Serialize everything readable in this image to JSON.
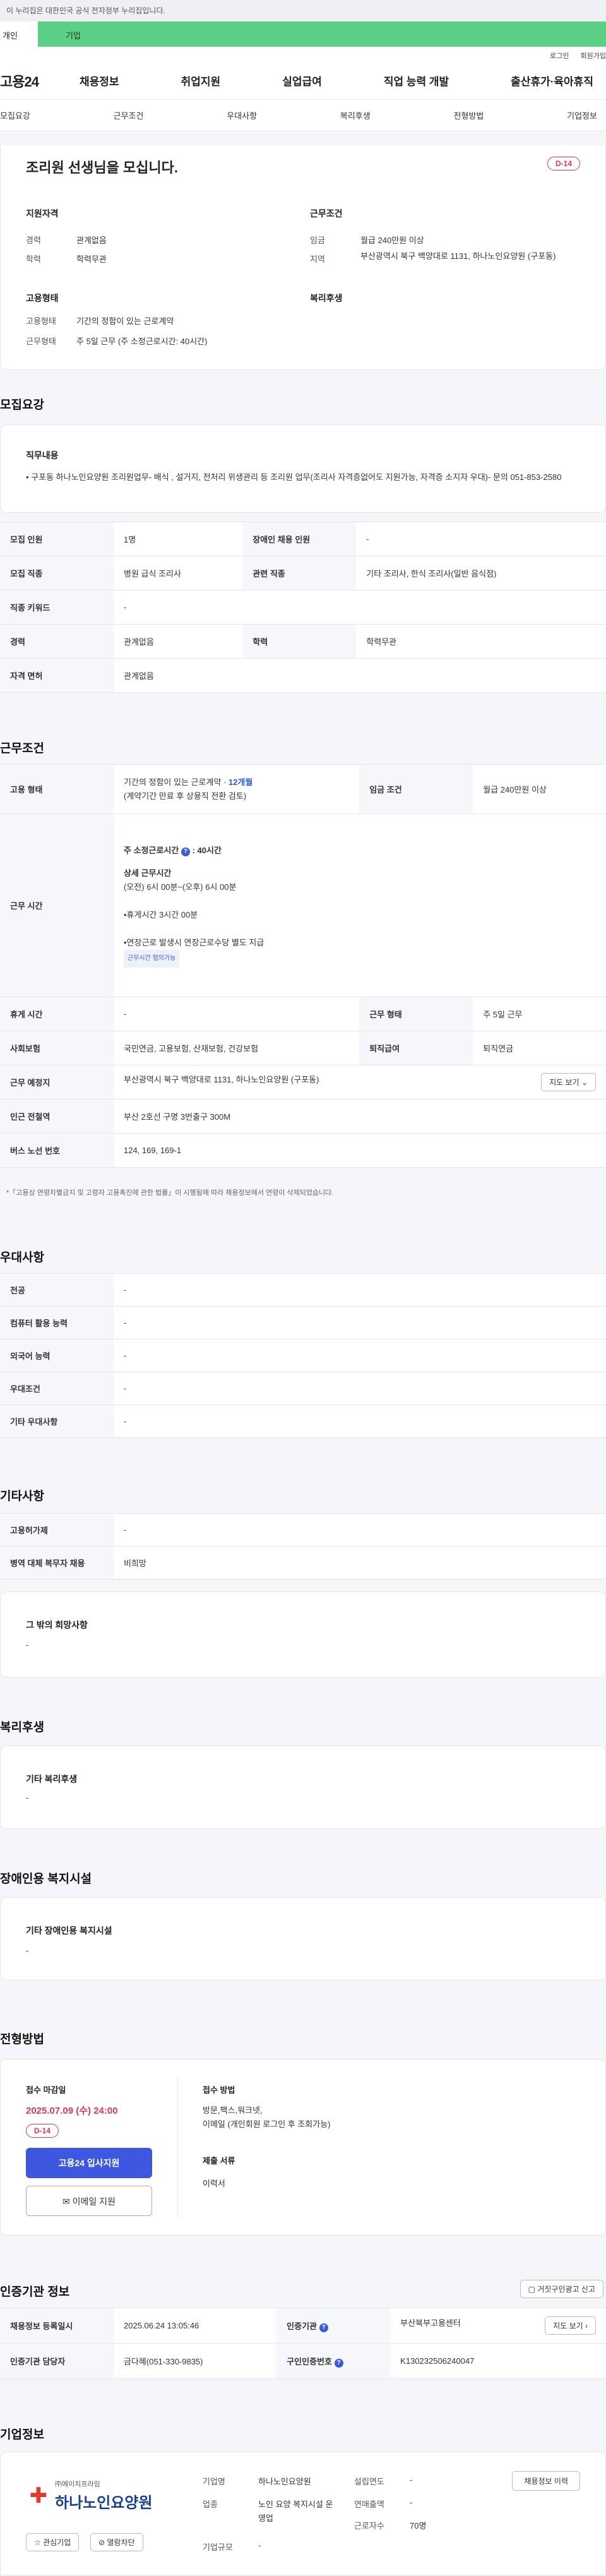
{
  "gov_banner": "이 누리집은 대한민국 공식 전자정부 누리집입니다.",
  "tabs": {
    "personal": "개인",
    "company": "기업"
  },
  "util": {
    "login": "로그인",
    "join": "회원가입"
  },
  "gnb": {
    "logo": "고용24",
    "menu": [
      "채용정보",
      "취업지원",
      "실업급여",
      "직업 능력 개발",
      "출산휴가·육아휴직"
    ]
  },
  "anchors": [
    "모집요강",
    "근무조건",
    "우대사항",
    "복리후생",
    "전형방법",
    "기업정보"
  ],
  "summary": {
    "title": "조리원 선생님을 모십니다.",
    "dday": "D-14",
    "qual_title": "지원자격",
    "career_l": "경력",
    "career_v": "관계없음",
    "edu_l": "학력",
    "edu_v": "학력무관",
    "cond_title": "근무조건",
    "wage_l": "임금",
    "wage_v": "월급 240만원 이상",
    "region_l": "지역",
    "region_v": "부산광역시 북구 백양대로 1131, 하나노인요양원 (구포동)",
    "emp_title": "고용형태",
    "emptype_l": "고용형태",
    "emptype_v": "기간의 정함이 있는 근로계약",
    "worktype_l": "근무형태",
    "worktype_v": "주 5일 근무 (주 소정근로시간: 40시간)",
    "welfare_title": "복리후생"
  },
  "recruit": {
    "title": "모집요강",
    "duty_title": "직무내용",
    "duty_text": "• 구포동 하나노인요양원 조리원업무- 배식 , 설거지, 전처리 위생관리 등 조리원 업무(조리사 자격증없어도 지원가능, 자격증 소지자 우대)- 문의 051-853-2580",
    "rows": [
      [
        "모집 인원",
        "1명",
        "장애인 채용 인원",
        "-"
      ],
      [
        "모집 직종",
        "병원 급식 조리사",
        "관련 직종",
        "기타 조리사, 한식 조리사(일반 음식점)"
      ],
      [
        "직종 키워드",
        "-"
      ],
      [
        "경력",
        "관계없음",
        "학력",
        "학력무관"
      ],
      [
        "자격 면허",
        "관계없음"
      ]
    ]
  },
  "work": {
    "title": "근무조건",
    "emp_l": "고용 형태",
    "emp_v1": "기간의 정함이 있는 근로계약 · ",
    "emp_v1b": "12개월",
    "emp_v2": "(계약기간 만료 후 상용직 전환 검토)",
    "wage_l": "임금 조건",
    "wage_v": "월급 240만원 이상",
    "time_l": "근무 시간",
    "time_weekly": "주 소정근로시간",
    "time_hours": "40시간",
    "time_detail_t": "상세 근무시간",
    "time_detail": "(오전) 6시 00분~(오후) 6시 00분",
    "time_break": "•휴게시간 3시간 00분",
    "time_extra": "•연장근로 발생시 연장근로수당 별도 지급",
    "time_chip": "근무시간 협의가능",
    "rest_l": "휴게 시간",
    "rest_v": "-",
    "form_l": "근무 형태",
    "form_v": "주 5일 근무",
    "ins_l": "사회보험",
    "ins_v": "국민연금, 고용보험, 산재보험, 건강보험",
    "pension_l": "퇴직급여",
    "pension_v": "퇴직연금",
    "place_l": "근무 예정지",
    "place_v": "부산광역시 북구 백양대로 1131, 하나노인요양원 (구포동)",
    "map_btn": "지도 보기",
    "sub_l": "인근 전철역",
    "sub_v": "부산 2호선 구명 3번출구 300M",
    "bus_l": "버스 노선 번호",
    "bus_v": "124, 169, 169-1",
    "note": "*「고용상 연령차별금지 및 고령자 고용촉진에 관한 법률」이 시행됨에 따라 채용정보에서 연령이 삭제되었습니다."
  },
  "pref": {
    "title": "우대사항",
    "rows": [
      [
        "전공",
        "-"
      ],
      [
        "컴퓨터 활용 능력",
        "-"
      ],
      [
        "외국어 능력",
        "-"
      ],
      [
        "우대조건",
        "-"
      ],
      [
        "기타 우대사항",
        "-"
      ]
    ]
  },
  "etc": {
    "title": "기타사항",
    "rows": [
      [
        "고용허가제",
        "-"
      ],
      [
        "병역 대체 복무자 채용",
        "비희망"
      ]
    ],
    "hope_t": "그 밖의 희망사항",
    "hope_v": "-"
  },
  "welfare": {
    "title": "복리후생",
    "t": "기타 복리후생",
    "v": "-"
  },
  "disab": {
    "title": "장애인용 복지시설",
    "t": "기타 장애인용 복지시설",
    "v": "-"
  },
  "process": {
    "title": "전형방법",
    "deadline_t": "접수 마감일",
    "deadline_v": "2025.07.09 (수) 24:00",
    "dday": "D-14",
    "apply_btn": "고용24 입사지원",
    "email_btn": "이메일 지원",
    "method_t": "접수 방법",
    "method_v1": "방문,팩스,워크넷,",
    "method_v2": "이메일 (개인회원 로그인 후 조회가능)",
    "docs_t": "제출 서류",
    "docs_v": "이력서"
  },
  "agency": {
    "title": "인증기관 정보",
    "report_btn": "거짓구인광고 신고",
    "reg_l": "채용정보 등록일시",
    "reg_v": "2025.06.24 13:05:46",
    "org_l": "인증기관",
    "org_v": "부산북부고용센터",
    "dir_btn": "지도 보기",
    "mgr_l": "인증기관 담당자",
    "mgr_v": "금다혜(051-330-9835)",
    "no_l": "구인인증번호",
    "no_v": "K130232506240047"
  },
  "company": {
    "title": "기업정보",
    "logo_sub": "㈜에이치프라임",
    "logo_name": "하나노인요양원",
    "fav_btn": "관심기업",
    "block_btn": "열람차단",
    "name_l": "기업명",
    "name_v": "하나노인요양원",
    "ind_l": "업종",
    "ind_v": "노인 요양 복지시설 운영업",
    "size_l": "기업규모",
    "size_v": "-",
    "est_l": "설립연도",
    "est_v": "-",
    "sales_l": "연매출액",
    "sales_v": "-",
    "emp_l": "근로자수",
    "emp_v": "70명",
    "jobs_btn": "채용정보 이력"
  }
}
